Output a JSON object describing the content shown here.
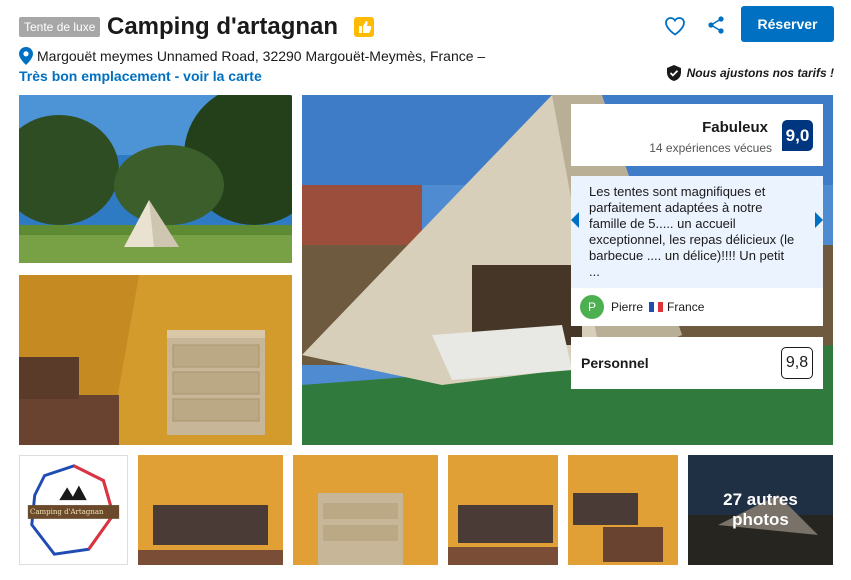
{
  "header": {
    "badge": "Tente de luxe",
    "title": "Camping d'artagnan",
    "address": "Margouët meymes Unnamed Road, 32290 Margouët-Meymès, France –",
    "map_link": "Très bon emplacement - voir la carte",
    "reserve_label": "Réserver",
    "price_match": "Nous ajustons nos tarifs !"
  },
  "rating": {
    "label": "Fabuleux",
    "count": "14 expériences vécues",
    "score": "9,0"
  },
  "review": {
    "text": "Les tentes sont magnifiques et parfaitement adaptées à notre famille de 5..... un accueil exceptionnel, les repas délicieux (le barbecue .... un délice)!!!! Un petit ...",
    "author_initial": "P",
    "author": "Pierre",
    "country": "France"
  },
  "staff": {
    "label": "Personnel",
    "score": "9,8"
  },
  "gallery": {
    "more_photos": "27 autres photos",
    "logo_text": "Camping d'Artagnan"
  },
  "colors": {
    "brand_blue": "#0071c2",
    "score_blue": "#003580",
    "thumb_yellow": "#febb02"
  }
}
